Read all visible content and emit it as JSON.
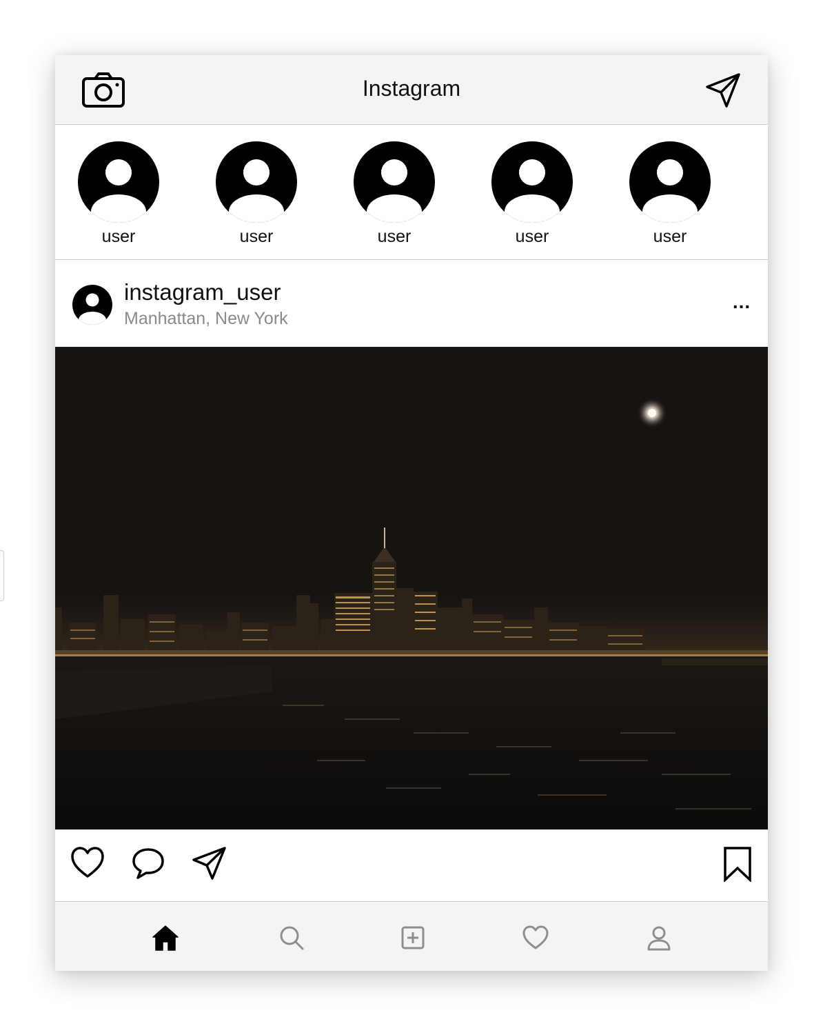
{
  "header": {
    "title": "Instagram",
    "camera_icon": "camera-icon",
    "direct_icon": "paper-plane-icon"
  },
  "stories": [
    {
      "name": "user"
    },
    {
      "name": "user"
    },
    {
      "name": "user"
    },
    {
      "name": "user"
    },
    {
      "name": "user"
    }
  ],
  "post": {
    "username": "instagram_user",
    "location": "Manhattan, New York",
    "more_label": "...",
    "photo_description_icon": "night-city-skyline-photo"
  },
  "actions": {
    "like_icon": "heart-icon",
    "comment_icon": "comment-icon",
    "share_icon": "paper-plane-icon",
    "save_icon": "bookmark-icon"
  },
  "tabbar": {
    "items": [
      {
        "icon": "home-icon",
        "active": true
      },
      {
        "icon": "search-icon",
        "active": false
      },
      {
        "icon": "add-post-icon",
        "active": false
      },
      {
        "icon": "heart-icon",
        "active": false
      },
      {
        "icon": "profile-icon",
        "active": false
      }
    ]
  },
  "colors": {
    "bar_background": "#f4f4f4",
    "divider": "#cfcfcf",
    "text": "#111111",
    "secondary_text": "#8a8a8a",
    "inactive_icon": "#8e8e8e",
    "photo_sky": "#161311"
  }
}
